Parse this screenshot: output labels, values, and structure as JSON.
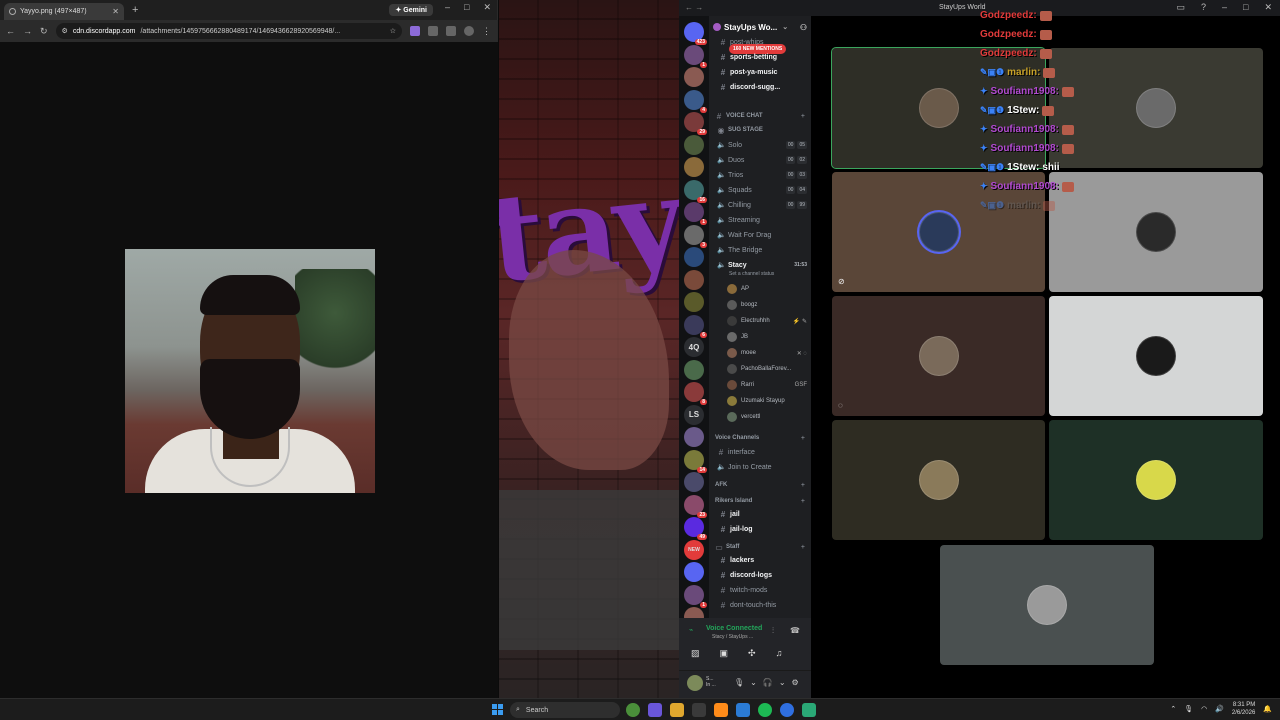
{
  "browser": {
    "tab_title": "Yayyo.png (497×487)",
    "new_tab": "+",
    "gemini_label": "Gemini",
    "url_host": "cdn.discordapp.com",
    "url_path": "/attachments/1459756662880489174/1469436628920569948/...",
    "win_min": "–",
    "win_max": "□",
    "win_close": "✕"
  },
  "discord": {
    "window_title": "StayUps World",
    "server_name": "StayUps Wo...",
    "mentions_pill": "160 NEW MENTIONS",
    "guild_badges": [
      "423",
      "1",
      "4",
      "29",
      "16",
      "1",
      "3",
      "6",
      "8",
      "14",
      "23",
      "49",
      "42",
      "1",
      "160"
    ],
    "guild_text_icons": [
      "4Q",
      "LS",
      "NEW"
    ],
    "text_channels_top": [
      {
        "name": "post-whips",
        "bright": false
      },
      {
        "name": "sports-betting",
        "bright": true
      },
      {
        "name": "post-ya-music",
        "bright": true
      },
      {
        "name": "discord-sugg...",
        "bright": true
      }
    ],
    "voice_category": "VOICE CHAT",
    "stage_label": "SUG STAGE",
    "voice_channels": [
      {
        "name": "Solo",
        "count": [
          "00",
          "05"
        ]
      },
      {
        "name": "Duos",
        "count": [
          "00",
          "02"
        ]
      },
      {
        "name": "Trios",
        "count": [
          "00",
          "03"
        ]
      },
      {
        "name": "Squads",
        "count": [
          "00",
          "04"
        ]
      },
      {
        "name": "Chilling",
        "count": [
          "00",
          "99"
        ]
      },
      {
        "name": "Streaming",
        "count": null
      },
      {
        "name": "Wait For Drag",
        "count": null
      },
      {
        "name": "The Bridge",
        "count": null
      }
    ],
    "active_channel": {
      "name": "Stacy",
      "timer": "31:53",
      "status_hint": "Set a channel status"
    },
    "members": [
      {
        "name": "AP",
        "right": ""
      },
      {
        "name": "boogz",
        "right": ""
      },
      {
        "name": "Electruhhh",
        "right": "⚡ ✎"
      },
      {
        "name": "JB",
        "right": ""
      },
      {
        "name": "moee",
        "right": "✕ ◌"
      },
      {
        "name": "PachoBallaForev...",
        "right": ""
      },
      {
        "name": "Rarri",
        "right": "GSF"
      },
      {
        "name": "Uzumaki Stayup",
        "right": ""
      },
      {
        "name": "vercettl",
        "right": ""
      }
    ],
    "voice_channels_cat": "Voice Channels",
    "interface_label": "interface",
    "join_label": "Join to Create",
    "afk_label": "AFK",
    "rikers_label": "Rikers Island",
    "jail_channels": [
      "jail",
      "jail-log"
    ],
    "staff_label": "Staff",
    "staff_channels": [
      {
        "name": "lackers",
        "bright": true
      },
      {
        "name": "discord-logs",
        "bright": true
      },
      {
        "name": "twitch-mods",
        "bright": false
      },
      {
        "name": "dont-touch-this",
        "bright": false
      }
    ],
    "voice_connected": "Voice Connected",
    "voice_sub": "Stacy / StayUps ...",
    "user_short": "S...",
    "user_status": "In ..."
  },
  "chat_overlay": [
    {
      "user": "Godzpeedz:",
      "color": "#e23b3b",
      "icon": "",
      "text": "",
      "emote": true
    },
    {
      "user": "Godzpeedz:",
      "color": "#e23b3b",
      "icon": "",
      "text": "",
      "emote": true
    },
    {
      "user": "Godzpeedz:",
      "color": "#e23b3b",
      "icon": "",
      "text": "",
      "emote": true
    },
    {
      "user": "marlin:",
      "color": "#c8a228",
      "icon": "✎▣❶",
      "text": "",
      "emote": true
    },
    {
      "user": "Soufiann1908:",
      "color": "#b24ad1",
      "icon": "✦",
      "text": "",
      "emote": true
    },
    {
      "user": "1Stew:",
      "color": "#ffffff",
      "icon": "✎▣❶",
      "text": "",
      "emote": true
    },
    {
      "user": "Soufiann1908:",
      "color": "#b24ad1",
      "icon": "✦",
      "text": "",
      "emote": true
    },
    {
      "user": "Soufiann1908:",
      "color": "#b24ad1",
      "icon": "✦",
      "text": "",
      "emote": true
    },
    {
      "user": "1Stew:",
      "color": "#ffffff",
      "icon": "✎▣❶",
      "text": "shii",
      "emote": false
    },
    {
      "user": "Soufiann1908:",
      "color": "#b24ad1",
      "icon": "✦",
      "text": "",
      "emote": true
    },
    {
      "user": "marlin:",
      "color": "#6b6b6b",
      "icon": "✎▣❶",
      "text": "",
      "emote": true
    }
  ],
  "taskbar": {
    "search": "Search",
    "time": "8:31 PM",
    "date": "2/6/2026"
  }
}
